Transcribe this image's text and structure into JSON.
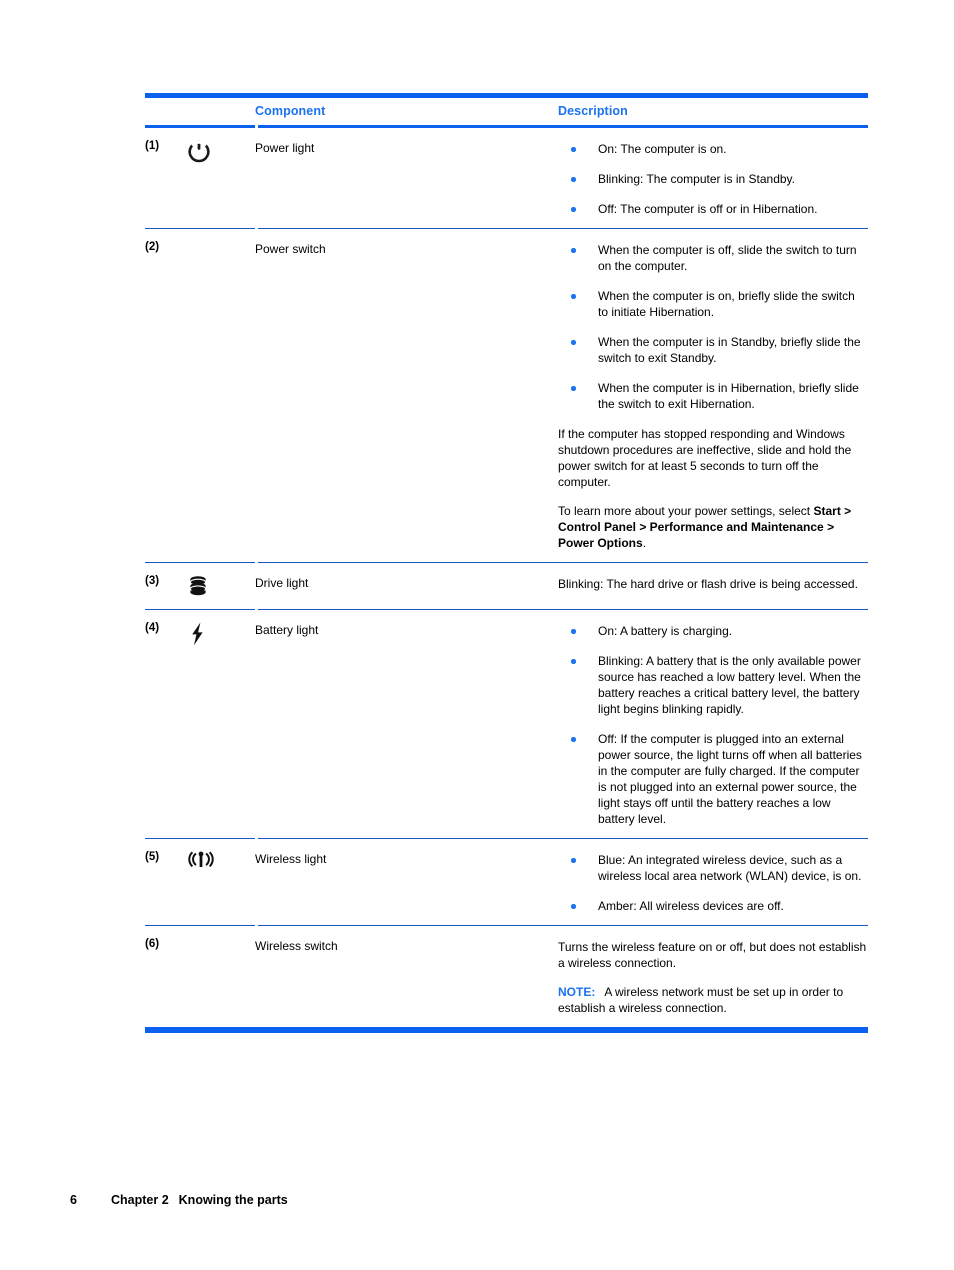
{
  "document": {
    "table": {
      "headers": {
        "component": "Component",
        "description": "Description"
      },
      "rows": [
        {
          "number": "(1)",
          "icon": "power-icon",
          "name": "Power light",
          "bullets": [
            "On: The computer is on.",
            "Blinking: The computer is in Standby.",
            "Off: The computer is off or in Hibernation."
          ],
          "paragraphs": []
        },
        {
          "number": "(2)",
          "icon": "none",
          "name": "Power switch",
          "bullets": [
            "When the computer is off, slide the switch to turn on the computer.",
            "When the computer is on, briefly slide the switch to initiate Hibernation.",
            "When the computer is in Standby, briefly slide the switch to exit Standby.",
            "When the computer is in Hibernation, briefly slide the switch to exit Hibernation."
          ],
          "paragraphs": [
            "If the computer has stopped responding and Windows shutdown procedures are ineffective, slide and hold the power switch for at least 5 seconds to turn off the computer."
          ],
          "settings_paragraph": {
            "lead": "To learn more about your power settings, select ",
            "path": "Start > Control Panel > Performance and Maintenance > Power Options",
            "tail": "."
          }
        },
        {
          "number": "(3)",
          "icon": "drive-icon",
          "name": "Drive light",
          "bullets": [],
          "paragraphs": [
            "Blinking: The hard drive or flash drive is being accessed."
          ]
        },
        {
          "number": "(4)",
          "icon": "battery-icon",
          "name": "Battery light",
          "bullets": [
            "On: A battery is charging.",
            "Blinking: A battery that is the only available power source has reached a low battery level. When the battery reaches a critical battery level, the battery light begins blinking rapidly.",
            "Off: If the computer is plugged into an external power source, the light turns off when all batteries in the computer are fully charged. If the computer is not plugged into an external power source, the light stays off until the battery reaches a low battery level."
          ],
          "paragraphs": []
        },
        {
          "number": "(5)",
          "icon": "wireless-icon",
          "name": "Wireless light",
          "bullets": [
            "Blue: An integrated wireless device, such as a wireless local area network (WLAN) device, is on.",
            "Amber: All wireless devices are off."
          ],
          "paragraphs": []
        },
        {
          "number": "(6)",
          "icon": "none",
          "name": "Wireless switch",
          "bullets": [],
          "paragraphs": [
            "Turns the wireless feature on or off, but does not establish a wireless connection."
          ],
          "note": {
            "label": "NOTE:",
            "text": "A wireless network must be set up in order to establish a wireless connection."
          }
        }
      ]
    },
    "footer": {
      "page_number": "6",
      "chapter": "Chapter 2",
      "title": "Knowing the parts"
    },
    "colors": {
      "accent_blue": "#0a60ef",
      "header_blue": "#1a73f0",
      "rule_blue": "#1a56c4",
      "text_black": "#000000"
    }
  }
}
